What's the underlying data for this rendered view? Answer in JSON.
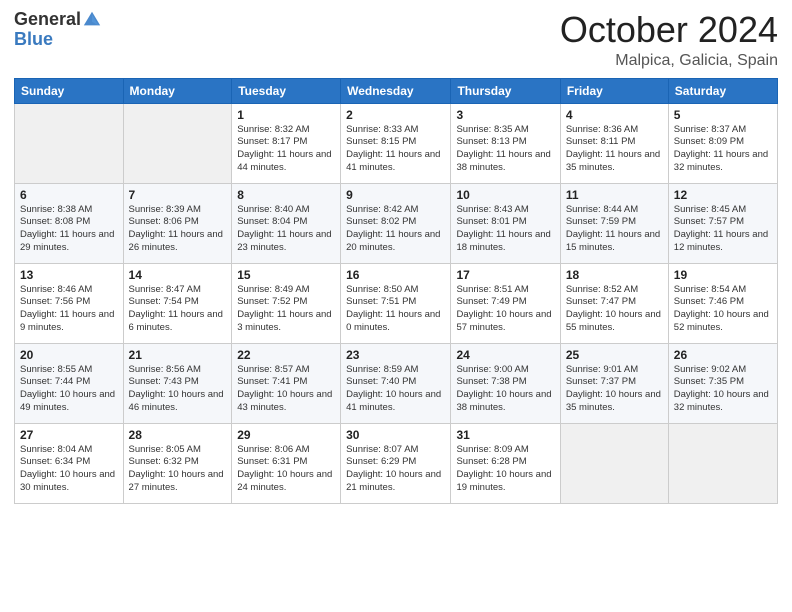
{
  "header": {
    "logo_general": "General",
    "logo_blue": "Blue",
    "month": "October 2024",
    "location": "Malpica, Galicia, Spain"
  },
  "weekdays": [
    "Sunday",
    "Monday",
    "Tuesday",
    "Wednesday",
    "Thursday",
    "Friday",
    "Saturday"
  ],
  "weeks": [
    [
      {
        "day": "",
        "info": ""
      },
      {
        "day": "",
        "info": ""
      },
      {
        "day": "1",
        "info": "Sunrise: 8:32 AM\nSunset: 8:17 PM\nDaylight: 11 hours and 44 minutes."
      },
      {
        "day": "2",
        "info": "Sunrise: 8:33 AM\nSunset: 8:15 PM\nDaylight: 11 hours and 41 minutes."
      },
      {
        "day": "3",
        "info": "Sunrise: 8:35 AM\nSunset: 8:13 PM\nDaylight: 11 hours and 38 minutes."
      },
      {
        "day": "4",
        "info": "Sunrise: 8:36 AM\nSunset: 8:11 PM\nDaylight: 11 hours and 35 minutes."
      },
      {
        "day": "5",
        "info": "Sunrise: 8:37 AM\nSunset: 8:09 PM\nDaylight: 11 hours and 32 minutes."
      }
    ],
    [
      {
        "day": "6",
        "info": "Sunrise: 8:38 AM\nSunset: 8:08 PM\nDaylight: 11 hours and 29 minutes."
      },
      {
        "day": "7",
        "info": "Sunrise: 8:39 AM\nSunset: 8:06 PM\nDaylight: 11 hours and 26 minutes."
      },
      {
        "day": "8",
        "info": "Sunrise: 8:40 AM\nSunset: 8:04 PM\nDaylight: 11 hours and 23 minutes."
      },
      {
        "day": "9",
        "info": "Sunrise: 8:42 AM\nSunset: 8:02 PM\nDaylight: 11 hours and 20 minutes."
      },
      {
        "day": "10",
        "info": "Sunrise: 8:43 AM\nSunset: 8:01 PM\nDaylight: 11 hours and 18 minutes."
      },
      {
        "day": "11",
        "info": "Sunrise: 8:44 AM\nSunset: 7:59 PM\nDaylight: 11 hours and 15 minutes."
      },
      {
        "day": "12",
        "info": "Sunrise: 8:45 AM\nSunset: 7:57 PM\nDaylight: 11 hours and 12 minutes."
      }
    ],
    [
      {
        "day": "13",
        "info": "Sunrise: 8:46 AM\nSunset: 7:56 PM\nDaylight: 11 hours and 9 minutes."
      },
      {
        "day": "14",
        "info": "Sunrise: 8:47 AM\nSunset: 7:54 PM\nDaylight: 11 hours and 6 minutes."
      },
      {
        "day": "15",
        "info": "Sunrise: 8:49 AM\nSunset: 7:52 PM\nDaylight: 11 hours and 3 minutes."
      },
      {
        "day": "16",
        "info": "Sunrise: 8:50 AM\nSunset: 7:51 PM\nDaylight: 11 hours and 0 minutes."
      },
      {
        "day": "17",
        "info": "Sunrise: 8:51 AM\nSunset: 7:49 PM\nDaylight: 10 hours and 57 minutes."
      },
      {
        "day": "18",
        "info": "Sunrise: 8:52 AM\nSunset: 7:47 PM\nDaylight: 10 hours and 55 minutes."
      },
      {
        "day": "19",
        "info": "Sunrise: 8:54 AM\nSunset: 7:46 PM\nDaylight: 10 hours and 52 minutes."
      }
    ],
    [
      {
        "day": "20",
        "info": "Sunrise: 8:55 AM\nSunset: 7:44 PM\nDaylight: 10 hours and 49 minutes."
      },
      {
        "day": "21",
        "info": "Sunrise: 8:56 AM\nSunset: 7:43 PM\nDaylight: 10 hours and 46 minutes."
      },
      {
        "day": "22",
        "info": "Sunrise: 8:57 AM\nSunset: 7:41 PM\nDaylight: 10 hours and 43 minutes."
      },
      {
        "day": "23",
        "info": "Sunrise: 8:59 AM\nSunset: 7:40 PM\nDaylight: 10 hours and 41 minutes."
      },
      {
        "day": "24",
        "info": "Sunrise: 9:00 AM\nSunset: 7:38 PM\nDaylight: 10 hours and 38 minutes."
      },
      {
        "day": "25",
        "info": "Sunrise: 9:01 AM\nSunset: 7:37 PM\nDaylight: 10 hours and 35 minutes."
      },
      {
        "day": "26",
        "info": "Sunrise: 9:02 AM\nSunset: 7:35 PM\nDaylight: 10 hours and 32 minutes."
      }
    ],
    [
      {
        "day": "27",
        "info": "Sunrise: 8:04 AM\nSunset: 6:34 PM\nDaylight: 10 hours and 30 minutes."
      },
      {
        "day": "28",
        "info": "Sunrise: 8:05 AM\nSunset: 6:32 PM\nDaylight: 10 hours and 27 minutes."
      },
      {
        "day": "29",
        "info": "Sunrise: 8:06 AM\nSunset: 6:31 PM\nDaylight: 10 hours and 24 minutes."
      },
      {
        "day": "30",
        "info": "Sunrise: 8:07 AM\nSunset: 6:29 PM\nDaylight: 10 hours and 21 minutes."
      },
      {
        "day": "31",
        "info": "Sunrise: 8:09 AM\nSunset: 6:28 PM\nDaylight: 10 hours and 19 minutes."
      },
      {
        "day": "",
        "info": ""
      },
      {
        "day": "",
        "info": ""
      }
    ]
  ]
}
